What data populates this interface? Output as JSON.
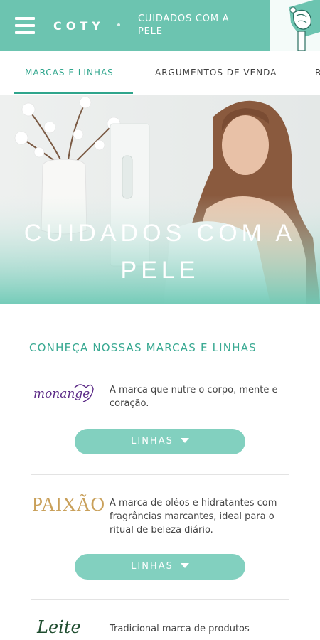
{
  "header": {
    "brand": "COTY",
    "section_title": "CUIDADOS COM A PELE"
  },
  "tabs": [
    {
      "label": "MARCAS E LINHAS",
      "active": true
    },
    {
      "label": "ARGUMENTOS DE VENDA",
      "active": false
    },
    {
      "label": "R",
      "active": false
    }
  ],
  "hero": {
    "title": "CUIDADOS COM A PELE"
  },
  "content": {
    "heading": "CONHEÇA NOSSAS MARCAS E LINHAS",
    "brands": [
      {
        "logo_text": "monange",
        "description": "A marca que nutre o corpo, mente e coração.",
        "button_label": "LINHAS"
      },
      {
        "logo_text": "PAIXÃO",
        "description": "A marca de oléos e hidratantes com fragrâncias marcantes, ideal para o ritual de beleza diário.",
        "button_label": "LINHAS"
      },
      {
        "logo_text": "Leite",
        "description": "Tradicional marca de produtos",
        "button_label": ""
      }
    ]
  },
  "colors": {
    "brand_teal": "#6cc4b0",
    "accent_dark_teal": "#2fa58c",
    "button_teal": "#82d0bf",
    "monange_purple": "#5b2a86",
    "paixao_gold": "#c9a05a"
  },
  "icons": [
    "menu-icon",
    "chevron-down-icon"
  ]
}
